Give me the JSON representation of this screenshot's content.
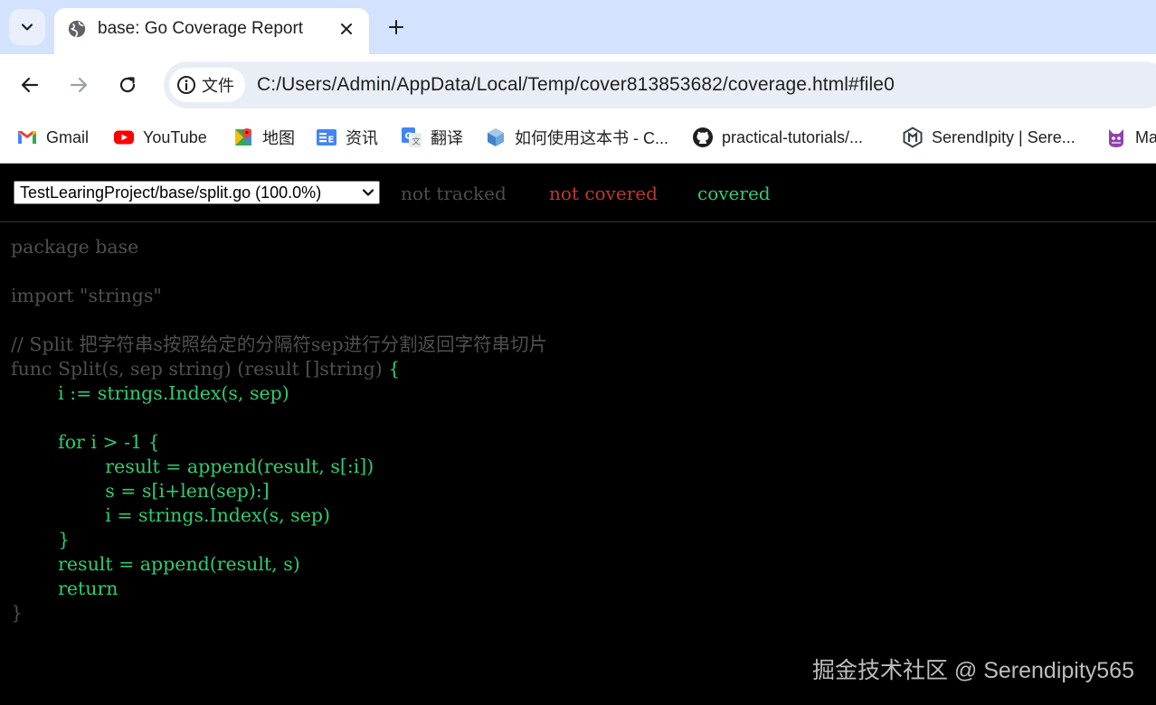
{
  "browser": {
    "tab": {
      "title": "base: Go Coverage Report"
    },
    "address": {
      "site_label": "文件",
      "url": "C:/Users/Admin/AppData/Local/Temp/cover813853682/coverage.html#file0"
    },
    "bookmarks": [
      {
        "label": "Gmail",
        "icon": "gmail-icon"
      },
      {
        "label": "YouTube",
        "icon": "youtube-icon"
      },
      {
        "label": "地图",
        "icon": "maps-icon"
      },
      {
        "label": "资讯",
        "icon": "news-icon"
      },
      {
        "label": "翻译",
        "icon": "translate-icon"
      },
      {
        "label": "如何使用这本书 - C...",
        "icon": "cube-icon"
      },
      {
        "label": "practical-tutorials/...",
        "icon": "github-icon"
      },
      {
        "label": "SerendIpity | Sere...",
        "icon": "hexagon-icon"
      },
      {
        "label": "Ma",
        "icon": "cat-icon"
      }
    ],
    "colors": {
      "tabstrip": "#d3e3fd",
      "toolbar": "#ffffff",
      "omnibox": "#e9eef6"
    }
  },
  "report": {
    "file_option": "TestLearingProject/base/split.go (100.0%)",
    "legend": {
      "not_tracked": "not tracked",
      "not_covered": "not covered",
      "covered": "covered"
    },
    "colors": {
      "not_tracked": "#4d4d4d",
      "not_covered": "#c0392b",
      "covered": "#2ecc71",
      "background": "#000000"
    },
    "code_lines": [
      {
        "segments": [
          {
            "text": "package base",
            "status": "nt"
          }
        ]
      },
      {
        "segments": [
          {
            "text": "",
            "status": "nt"
          }
        ]
      },
      {
        "segments": [
          {
            "text": "import \"strings\"",
            "status": "nt"
          }
        ]
      },
      {
        "segments": [
          {
            "text": "",
            "status": "nt"
          }
        ]
      },
      {
        "segments": [
          {
            "text": "// Split 把字符串s按照给定的分隔符sep进行分割返回字符串切片",
            "status": "nt"
          }
        ]
      },
      {
        "segments": [
          {
            "text": "func Split(s, sep string) (result []string) ",
            "status": "nt"
          },
          {
            "text": "{",
            "status": "cv"
          }
        ]
      },
      {
        "segments": [
          {
            "text": "        i := strings.Index(s, sep)",
            "status": "cv"
          }
        ]
      },
      {
        "segments": [
          {
            "text": "",
            "status": "cv"
          }
        ]
      },
      {
        "segments": [
          {
            "text": "        for i > -1 {",
            "status": "cv"
          }
        ]
      },
      {
        "segments": [
          {
            "text": "                result = append(result, s[:i])",
            "status": "cv"
          }
        ]
      },
      {
        "segments": [
          {
            "text": "                s = s[i+len(sep):]",
            "status": "cv"
          }
        ]
      },
      {
        "segments": [
          {
            "text": "                i = strings.Index(s, sep)",
            "status": "cv"
          }
        ]
      },
      {
        "segments": [
          {
            "text": "        }",
            "status": "cv"
          }
        ]
      },
      {
        "segments": [
          {
            "text": "        result = append(result, s)",
            "status": "cv"
          }
        ]
      },
      {
        "segments": [
          {
            "text": "        return",
            "status": "cv"
          }
        ]
      },
      {
        "segments": [
          {
            "text": "}",
            "status": "nt"
          }
        ]
      }
    ]
  },
  "watermark": "掘金技术社区 @ Serendipity565"
}
